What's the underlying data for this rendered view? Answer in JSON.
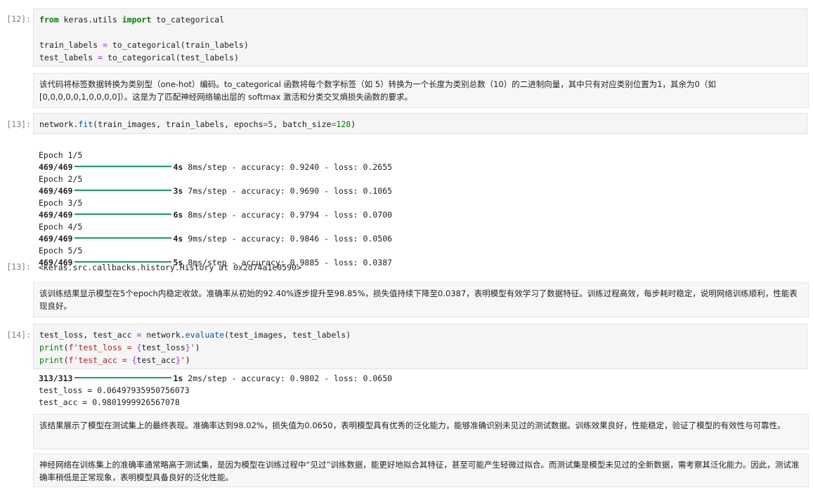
{
  "cells": [
    {
      "prompt": "[12]:",
      "code_lines": [
        "from keras.utils import to_categorical",
        "",
        "train_labels = to_categorical(train_labels)",
        "test_labels = to_categorical(test_labels)"
      ]
    },
    {
      "markdown": "该代码将标签数据转换为类别型（one-hot）编码。to_categorical 函数将每个数字标签（如 5）转换为一个长度为类别总数（10）的二进制向量，其中只有对应类别位置为1，其余为0（如 [0,0,0,0,0,1,0,0,0,0]）。这是为了匹配神经网络输出层的 softmax 激活和分类交叉熵损失函数的要求。"
    },
    {
      "prompt": "[13]:",
      "code_lines": [
        "network.fit(train_images, train_labels, epochs=5, batch_size=128)"
      ],
      "output": [
        {
          "epoch": "Epoch 1/5",
          "steps": "469/469",
          "time": "4s",
          "rest": "8ms/step - accuracy: 0.9240 - loss: 0.2655"
        },
        {
          "epoch": "Epoch 2/5",
          "steps": "469/469",
          "time": "3s",
          "rest": "7ms/step - accuracy: 0.9690 - loss: 0.1065"
        },
        {
          "epoch": "Epoch 3/5",
          "steps": "469/469",
          "time": "6s",
          "rest": "8ms/step - accuracy: 0.9794 - loss: 0.0700"
        },
        {
          "epoch": "Epoch 4/5",
          "steps": "469/469",
          "time": "4s",
          "rest": "9ms/step - accuracy: 0.9846 - loss: 0.0506"
        },
        {
          "epoch": "Epoch 5/5",
          "steps": "469/469",
          "time": "5s",
          "rest": "8ms/step - accuracy: 0.9885 - loss: 0.0387"
        }
      ],
      "result_prompt": "[13]:",
      "result": "<keras.src.callbacks.history.History at 0x2d74a1e0590>"
    },
    {
      "markdown": "该训练结果显示模型在5个epoch内稳定收敛。准确率从初始的92.40%逐步提升至98.85%，损失值持续下降至0.0387，表明模型有效学习了数据特征。训练过程高效，每步耗时稳定，说明网络训练顺利，性能表现良好。"
    },
    {
      "prompt": "[14]:",
      "code_lines": [
        "test_loss, test_acc = network.evaluate(test_images, test_labels)",
        "print(f'test_loss = {test_loss}')",
        "print(f'test_acc = {test_acc}')"
      ],
      "eval_steps": "313/313",
      "eval_time": "1s",
      "eval_rest": "2ms/step - accuracy: 0.9802 - loss: 0.0650",
      "print_lines": [
        "test_loss = 0.06497935950756073",
        "test_acc = 0.9801999926567078"
      ]
    },
    {
      "markdown": "该结果展示了模型在测试集上的最终表现。准确率达到98.02%，损失值为0.0650，表明模型具有优秀的泛化能力，能够准确识别未见过的测试数据。训练效果良好，性能稳定，验证了模型的有效性与可靠性。"
    },
    {
      "markdown": "神经网络在训练集上的准确率通常略高于测试集，是因为模型在训练过程中“见过”训练数据，能更好地拟合其特征，甚至可能产生轻微过拟合。而测试集是模型未见过的全新数据，需考察其泛化能力。因此，测试准确率稍低是正常现象，表明模型具备良好的泛化性能。"
    }
  ],
  "colors": {
    "progress_bar": "#11a35a",
    "keyword": "#008000",
    "function": "#0055aa",
    "operator": "#aa22ff"
  }
}
